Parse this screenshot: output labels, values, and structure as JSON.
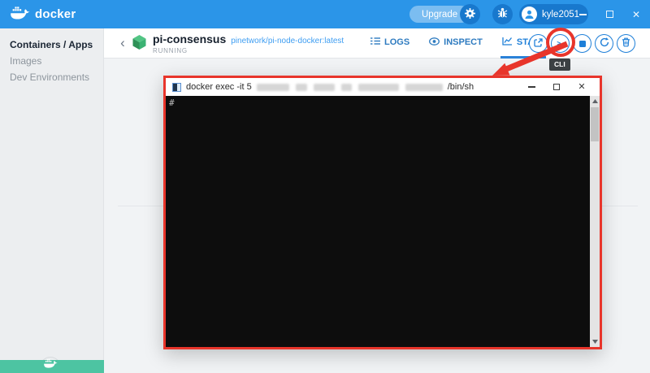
{
  "app": {
    "brand": "docker",
    "window_controls": {
      "close_glyph": "✕"
    }
  },
  "topbar": {
    "upgrade_label": "Upgrade",
    "username": "kyle2051"
  },
  "sidebar": {
    "items": [
      {
        "label": "Containers / Apps",
        "active": true
      },
      {
        "label": "Images",
        "active": false
      },
      {
        "label": "Dev Environments",
        "active": false
      }
    ]
  },
  "header": {
    "container_name": "pi-consensus",
    "image_name": "pinetwork/pi-node-docker:latest",
    "status": "RUNNING",
    "tabs": [
      {
        "label": "LOGS",
        "active": false
      },
      {
        "label": "INSPECT",
        "active": false
      },
      {
        "label": "STATS",
        "active": true
      }
    ],
    "action_icons": [
      "open-external",
      "cli",
      "stop",
      "restart",
      "delete"
    ],
    "tooltip": "CLI"
  },
  "terminal": {
    "title_prefix": "docker exec -it 5",
    "title_suffix": "/bin/sh",
    "prompt": "#",
    "window_controls": {
      "close_glyph": "✕"
    }
  },
  "icons": {
    "brand_logo": "docker-whale",
    "topbar": [
      "gear",
      "bug",
      "user-avatar"
    ],
    "tabs": [
      "log-list",
      "eye",
      "line-chart"
    ],
    "scrollbar": [
      "arrow-up",
      "arrow-down"
    ],
    "footer": "docker-whale"
  },
  "colors": {
    "topbar_blue": "#2b95e8",
    "accent_blue": "#1e7fd8",
    "link_blue": "#3f9ef2",
    "annotation_red": "#e8352b",
    "footer_teal": "#4dc4a2",
    "terminal_bg": "#0d0d0d",
    "cube_green": "#3eb36f"
  }
}
